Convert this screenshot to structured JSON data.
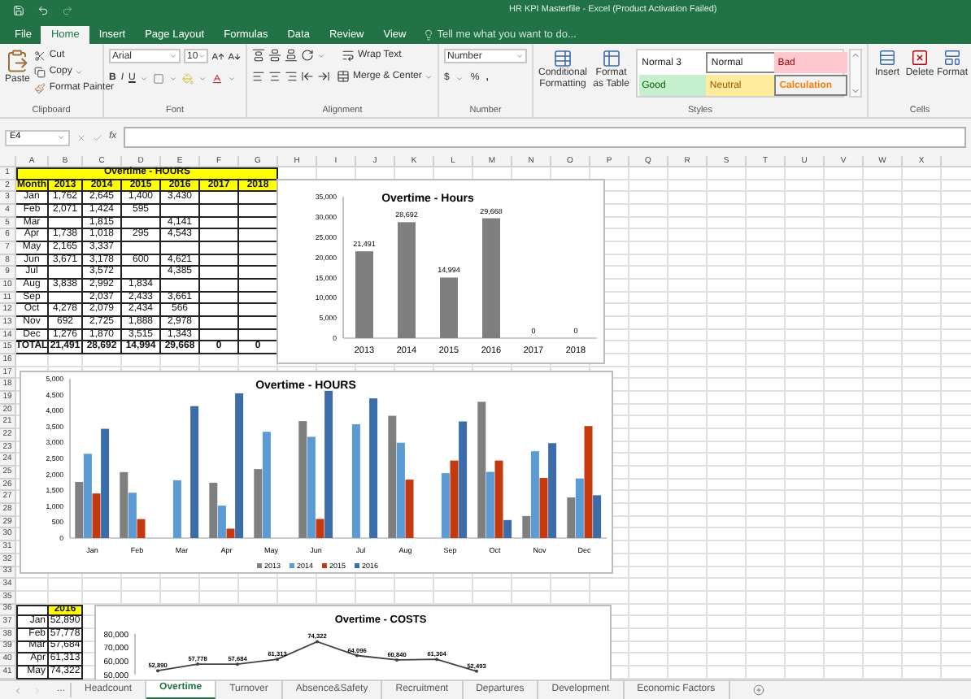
{
  "window": {
    "title": "HR KPI Masterfile - Excel (Product Activation Failed)"
  },
  "ribbon_tabs": [
    {
      "label": "File",
      "selected": false
    },
    {
      "label": "Home",
      "selected": true
    },
    {
      "label": "Insert",
      "selected": false
    },
    {
      "label": "Page Layout",
      "selected": false
    },
    {
      "label": "Formulas",
      "selected": false
    },
    {
      "label": "Data",
      "selected": false
    },
    {
      "label": "Review",
      "selected": false
    },
    {
      "label": "View",
      "selected": false
    }
  ],
  "tell_me": {
    "placeholder": "Tell me what you want to do..."
  },
  "ribbon": {
    "clipboard": {
      "paste": "Paste",
      "cut": "Cut",
      "copy": "Copy",
      "format_painter": "Format Painter",
      "label": "Clipboard"
    },
    "font": {
      "name": "Arial",
      "size": "10",
      "bold": "B",
      "italic": "I",
      "underline": "U",
      "label": "Font"
    },
    "alignment": {
      "wrap": "Wrap Text",
      "merge": "Merge & Center",
      "label": "Alignment"
    },
    "number": {
      "format": "Number",
      "currency": "$",
      "percent": "%",
      "comma": ",",
      "label": "Number"
    },
    "styles": {
      "conditional": "Conditional Formatting",
      "format_table": "Format as Table",
      "cell_styles": [
        {
          "label": "Normal 3",
          "kind": "normal3"
        },
        {
          "label": "Normal",
          "kind": "normal"
        },
        {
          "label": "Bad",
          "kind": "bad"
        },
        {
          "label": "Good",
          "kind": "good"
        },
        {
          "label": "Neutral",
          "kind": "neutral"
        },
        {
          "label": "Calculation",
          "kind": "calculation"
        }
      ],
      "label": "Styles"
    },
    "cells": {
      "buttons": [
        "Insert",
        "Delete",
        "Format"
      ],
      "label": "Cells"
    }
  },
  "formula_bar": {
    "name_box": "E4",
    "fx": "fx"
  },
  "sheet": {
    "columns": [
      "A",
      "B",
      "C",
      "D",
      "E",
      "F",
      "G",
      "H",
      "I",
      "J",
      "K",
      "L",
      "M",
      "N",
      "O",
      "P",
      "Q",
      "R",
      "S",
      "T",
      "U",
      "V",
      "W",
      "X"
    ],
    "row_numbers": [
      "1",
      "2",
      "3",
      "4",
      "5",
      "6",
      "7",
      "8",
      "9",
      "10",
      "11",
      "12",
      "13",
      "14",
      "15",
      "16",
      "17",
      "18",
      "19",
      "20",
      "21",
      "22",
      "23",
      "24",
      "25",
      "26",
      "27",
      "28",
      "29",
      "30",
      "31",
      "32",
      "33",
      "34",
      "35",
      "36",
      "37",
      "38",
      "39",
      "40",
      "41"
    ],
    "hours_table": {
      "title": "Overtime - HOURS",
      "header": [
        "Month",
        "2013",
        "2014",
        "2015",
        "2016",
        "2017",
        "2018"
      ],
      "rows": [
        {
          "month": "Jan",
          "y2013": "1,762",
          "y2014": "2,645",
          "y2015": "1,400",
          "y2016": "3,430"
        },
        {
          "month": "Feb",
          "y2013": "2,071",
          "y2014": "1,424",
          "y2015": "595"
        },
        {
          "month": "Mar",
          "y2014": "1,815",
          "y2016": "4,141"
        },
        {
          "month": "Apr",
          "y2013": "1,738",
          "y2014": "1,018",
          "y2015": "295",
          "y2016": "4,543"
        },
        {
          "month": "May",
          "y2013": "2,165",
          "y2014": "3,337"
        },
        {
          "month": "Jun",
          "y2013": "3,671",
          "y2014": "3,178",
          "y2015": "600",
          "y2016": "4,621"
        },
        {
          "month": "Jul",
          "y2014": "3,572",
          "y2016": "4,385"
        },
        {
          "month": "Aug",
          "y2013": "3,838",
          "y2014": "2,992",
          "y2015": "1,834"
        },
        {
          "month": "Sep",
          "y2014": "2,037",
          "y2015": "2,433",
          "y2016": "3,661"
        },
        {
          "month": "Oct",
          "y2013": "4,278",
          "y2014": "2,079",
          "y2015": "2,434",
          "y2016": "566"
        },
        {
          "month": "Nov",
          "y2013": "692",
          "y2014": "2,725",
          "y2015": "1,888",
          "y2016": "2,978"
        },
        {
          "month": "Dec",
          "y2013": "1,276",
          "y2014": "1,870",
          "y2015": "3,515",
          "y2016": "1,343"
        }
      ],
      "total": {
        "month": "TOTAL",
        "y2013": "21,491",
        "y2014": "28,692",
        "y2015": "14,994",
        "y2016": "29,668",
        "y2017": "0",
        "y2018": "0"
      }
    },
    "costs_table": {
      "header": "2016",
      "rows": [
        {
          "month": "Jan",
          "value": "52,890"
        },
        {
          "month": "Feb",
          "value": "57,778"
        },
        {
          "month": "Mar",
          "value": "57,684"
        },
        {
          "month": "Apr",
          "value": "61,313"
        },
        {
          "month": "May",
          "value": "74,322"
        }
      ]
    },
    "charts": [
      {
        "chart_data": {
          "type": "bar",
          "title": "Overtime - Hours",
          "categories": [
            "2013",
            "2014",
            "2015",
            "2016",
            "2017",
            "2018"
          ],
          "series": [
            {
              "color": "#7f7f7f",
              "values": [
                21491,
                28692,
                14994,
                29668,
                0,
                0
              ],
              "value_labels": [
                "21,491",
                "28,692",
                "14,994",
                "29,668",
                "0",
                "0"
              ]
            }
          ],
          "data_labels": true,
          "ylim": [
            0,
            35000
          ],
          "yticks": [
            {
              "value": 0,
              "label": "0"
            },
            {
              "value": 5000,
              "label": "5,000"
            },
            {
              "value": 10000,
              "label": "10,000"
            },
            {
              "value": 15000,
              "label": "15,000"
            },
            {
              "value": 20000,
              "label": "20,000"
            },
            {
              "value": 25000,
              "label": "25,000"
            },
            {
              "value": 30000,
              "label": "30,000"
            },
            {
              "value": 35000,
              "label": "35,000"
            }
          ]
        }
      },
      {
        "chart_data": {
          "type": "bar",
          "title": "Overtime - HOURS",
          "categories": [
            "Jan",
            "Feb",
            "Mar",
            "Apr",
            "May",
            "Jun",
            "Jul",
            "Aug",
            "Sep",
            "Oct",
            "Nov",
            "Dec"
          ],
          "legend": "bottom",
          "series": [
            {
              "name": "2013",
              "color": "#7f7f7f",
              "values": [
                1762,
                2071,
                null,
                1738,
                2165,
                3671,
                null,
                3838,
                null,
                4278,
                692,
                1276
              ]
            },
            {
              "name": "2014",
              "color": "#5b9bd5",
              "values": [
                2645,
                1424,
                1815,
                1018,
                3337,
                3178,
                3572,
                2992,
                2037,
                2079,
                2725,
                1870
              ]
            },
            {
              "name": "2015",
              "color": "#c5390f",
              "values": [
                1400,
                595,
                null,
                295,
                null,
                600,
                null,
                1834,
                2433,
                2434,
                1888,
                3515
              ]
            },
            {
              "name": "2016",
              "color": "#3d6da8",
              "values": [
                3430,
                null,
                4141,
                4543,
                null,
                4621,
                4385,
                null,
                3661,
                566,
                2978,
                1343
              ]
            }
          ],
          "ylim": [
            0,
            5000
          ],
          "yticks": [
            {
              "value": 0,
              "label": "0"
            },
            500,
            {
              "value": 1000,
              "label": "1,000"
            },
            {
              "value": 1500,
              "label": "1,500"
            },
            {
              "value": 2000,
              "label": "2,000"
            },
            {
              "value": 2500,
              "label": "2,500"
            },
            {
              "value": 3000,
              "label": "3,000"
            },
            {
              "value": 3500,
              "label": "3,500"
            },
            {
              "value": 4000,
              "label": "4,000"
            },
            {
              "value": 4500,
              "label": "4,500"
            },
            {
              "value": 5000,
              "label": "5,000"
            }
          ]
        }
      },
      {
        "chart_data": {
          "type": "line",
          "title": "Overtime - COSTS",
          "series": [
            {
              "color": "#404040",
              "values": [
                52890,
                57778,
                57684,
                61313,
                74322,
                64096,
                60840,
                61304,
                52493
              ],
              "value_labels": [
                "52,890",
                "57,778",
                "57,684",
                "61,313",
                "74,322",
                "64,096",
                "60,840",
                "61,304",
                "52,493"
              ]
            }
          ],
          "data_labels": true,
          "ylim": [
            50000,
            80000
          ],
          "yticks": [
            {
              "value": 50000,
              "label": "50,000"
            },
            {
              "value": 60000,
              "label": "60,000"
            },
            {
              "value": 70000,
              "label": "70,000"
            },
            {
              "value": 80000,
              "label": "80,000"
            }
          ]
        }
      }
    ]
  },
  "sheet_tabs": {
    "overflow": "...",
    "tabs": [
      {
        "label": "Headcount",
        "selected": false
      },
      {
        "label": "Overtime",
        "selected": true
      },
      {
        "label": "Turnover",
        "selected": false
      },
      {
        "label": "Absence&Safety",
        "selected": false
      },
      {
        "label": "Recruitment",
        "selected": false
      },
      {
        "label": "Departures",
        "selected": false
      },
      {
        "label": "Development",
        "selected": false
      },
      {
        "label": "Economic Factors",
        "selected": false
      }
    ]
  }
}
